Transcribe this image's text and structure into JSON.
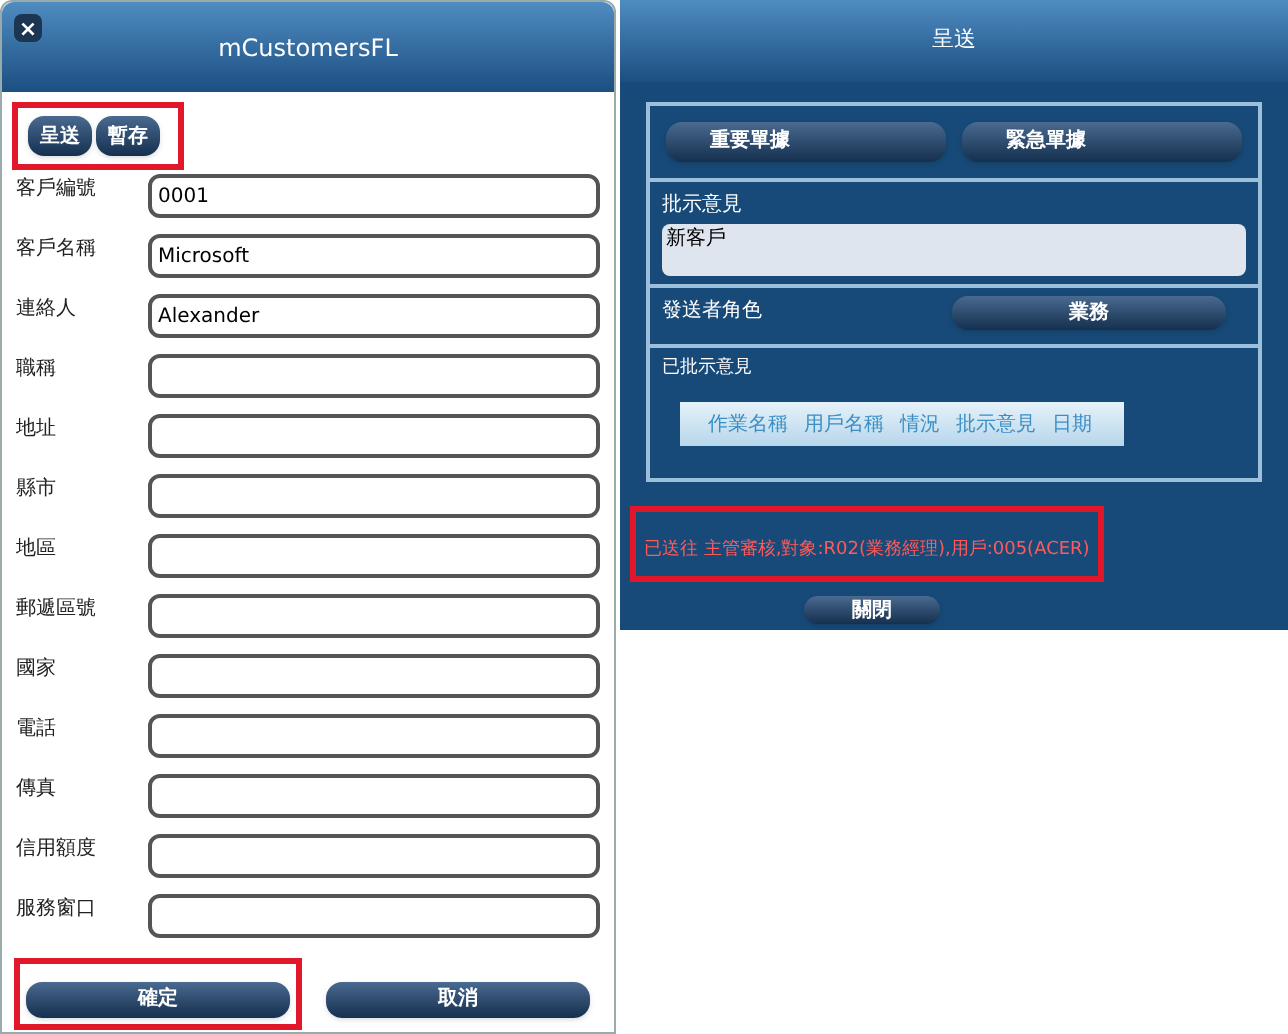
{
  "left_dialog": {
    "title": "mCustomersFL",
    "close_icon": "×",
    "toolbar": {
      "highlighted": true,
      "buttons": [
        "呈送",
        "暫存"
      ]
    },
    "fields": [
      {
        "label": "客戶編號",
        "value": "0001"
      },
      {
        "label": "客戶名稱",
        "value": "Microsoft"
      },
      {
        "label": "連絡人",
        "value": "Alexander"
      },
      {
        "label": "職稱"
      },
      {
        "label": "地址"
      },
      {
        "label": "縣市"
      },
      {
        "label": "地區"
      },
      {
        "label": "郵遞區號"
      },
      {
        "label": "國家"
      },
      {
        "label": "電話"
      },
      {
        "label": "傳真"
      },
      {
        "label": "信用額度"
      },
      {
        "label": "服務窗口"
      }
    ],
    "footer_buttons": [
      {
        "label": "確定",
        "highlighted": true
      },
      {
        "label": "取消",
        "highlighted": false
      }
    ]
  },
  "right_dialog": {
    "title": "呈送",
    "flag_buttons": [
      "重要單據",
      "緊急單據"
    ],
    "comment": {
      "label": "批示意見",
      "value": "新客戶"
    },
    "sender_role": {
      "label": "發送者角色",
      "button": "業務"
    },
    "history": {
      "label": "已批示意見",
      "columns": [
        "作業名稱",
        "用戶名稱",
        "情況",
        "批示意見",
        "日期"
      ]
    },
    "message": {
      "text": "已送往 主管審核,對象:R02(業務經理),用戶:005(ACER)",
      "highlighted": true
    },
    "close_button": "關閉"
  }
}
